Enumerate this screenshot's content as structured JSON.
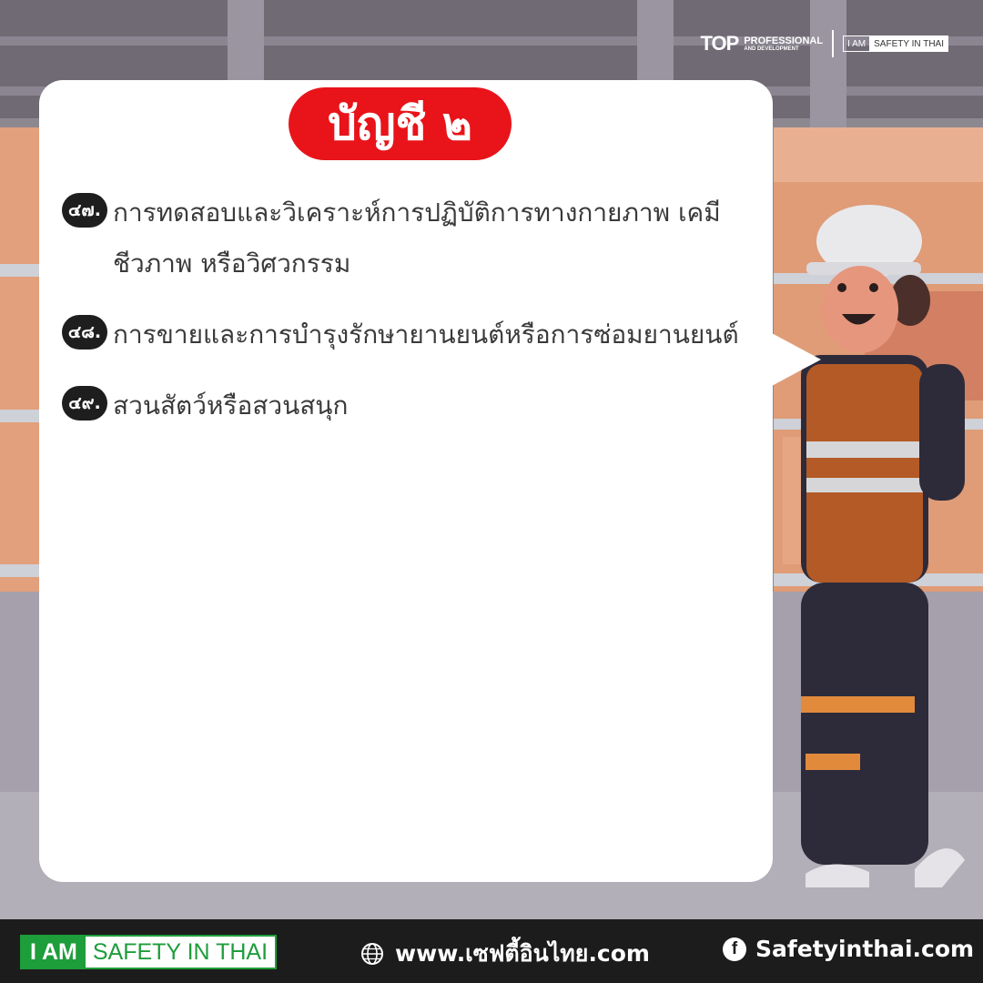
{
  "header": {
    "logo_top_brand": "TOP",
    "logo_top_line1": "PROFESSIONAL",
    "logo_top_line2": "AND DEVELOPMENT",
    "logo_badge_left": "I AM",
    "logo_badge_right": "SAFETY IN THAI"
  },
  "card": {
    "title": "บัญชี ๒",
    "items": [
      {
        "number": "๔๗.",
        "text": "การทดสอบและวิเคราะห์การปฏิบัติการทางกายภาพ เคมี ชีวภาพ หรือวิศวกรรม"
      },
      {
        "number": "๔๘.",
        "text": "การขายและการบำรุงรักษายานยนต์หรือการซ่อมยานยนต์"
      },
      {
        "number": "๔๙.",
        "text": "สวนสัตว์หรือสวนสนุก"
      }
    ]
  },
  "footer": {
    "badge_left": "I AM",
    "badge_right": "SAFETY IN THAI",
    "website": "www.เซฟตี้อินไทย.com",
    "facebook": "Safetyinthai.com",
    "website_icon": "globe-icon",
    "facebook_icon": "facebook-icon"
  },
  "colors": {
    "accent_red": "#e8141a",
    "brand_green": "#1e9d3b",
    "footer_bg": "#1c1c1c"
  }
}
